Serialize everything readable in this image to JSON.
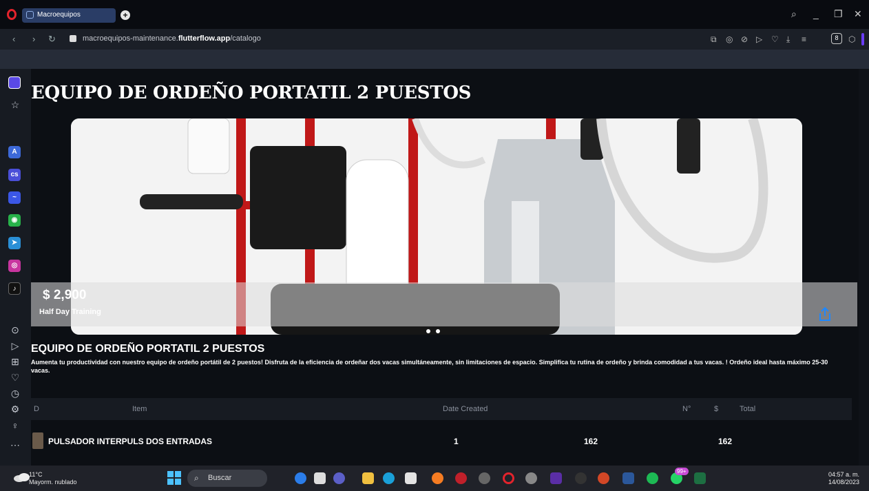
{
  "browser": {
    "tab_title": "Macroequipos",
    "url_prefix": "macroequipos-maintenance.",
    "url_domain": "flutterflow.app",
    "url_path": "/catalogo",
    "account_letter": "8"
  },
  "product": {
    "title": "EQUIPO DE ORDEÑO PORTATIL 2 PUESTOS",
    "price": "$ 2,900",
    "subtitle": "Half Day Training",
    "section_title": "EQUIPO DE ORDEÑO PORTATIL 2 PUESTOS",
    "description": "Aumenta tu productividad con nuestro equipo de ordeño portátil de 2 puestos! Disfruta de la eficiencia de ordeñar dos vacas simultáneamente, sin limitaciones de espacio. Simplifica tu rutina de ordeño y brinda comodidad a tus vacas. ! Ordeño ideal hasta máximo 25-30 vacas."
  },
  "table": {
    "headers": [
      "D",
      "Item",
      "Date Created",
      "N°",
      "$",
      "Total"
    ],
    "rows": [
      {
        "item": "PULSADOR INTERPULS DOS ENTRADAS",
        "qty": "1",
        "price": "162",
        "total": "162"
      }
    ]
  },
  "taskbar": {
    "temp": "11°C",
    "weather": "Mayorm. nublado",
    "search": "Buscar",
    "time": "04:57 a. m.",
    "date": "14/08/2023",
    "whatsapp_badge": "99+"
  },
  "colors": {
    "accent": "#1e88ff",
    "brand_red": "#e3232c",
    "tab": "#2a3d66"
  }
}
